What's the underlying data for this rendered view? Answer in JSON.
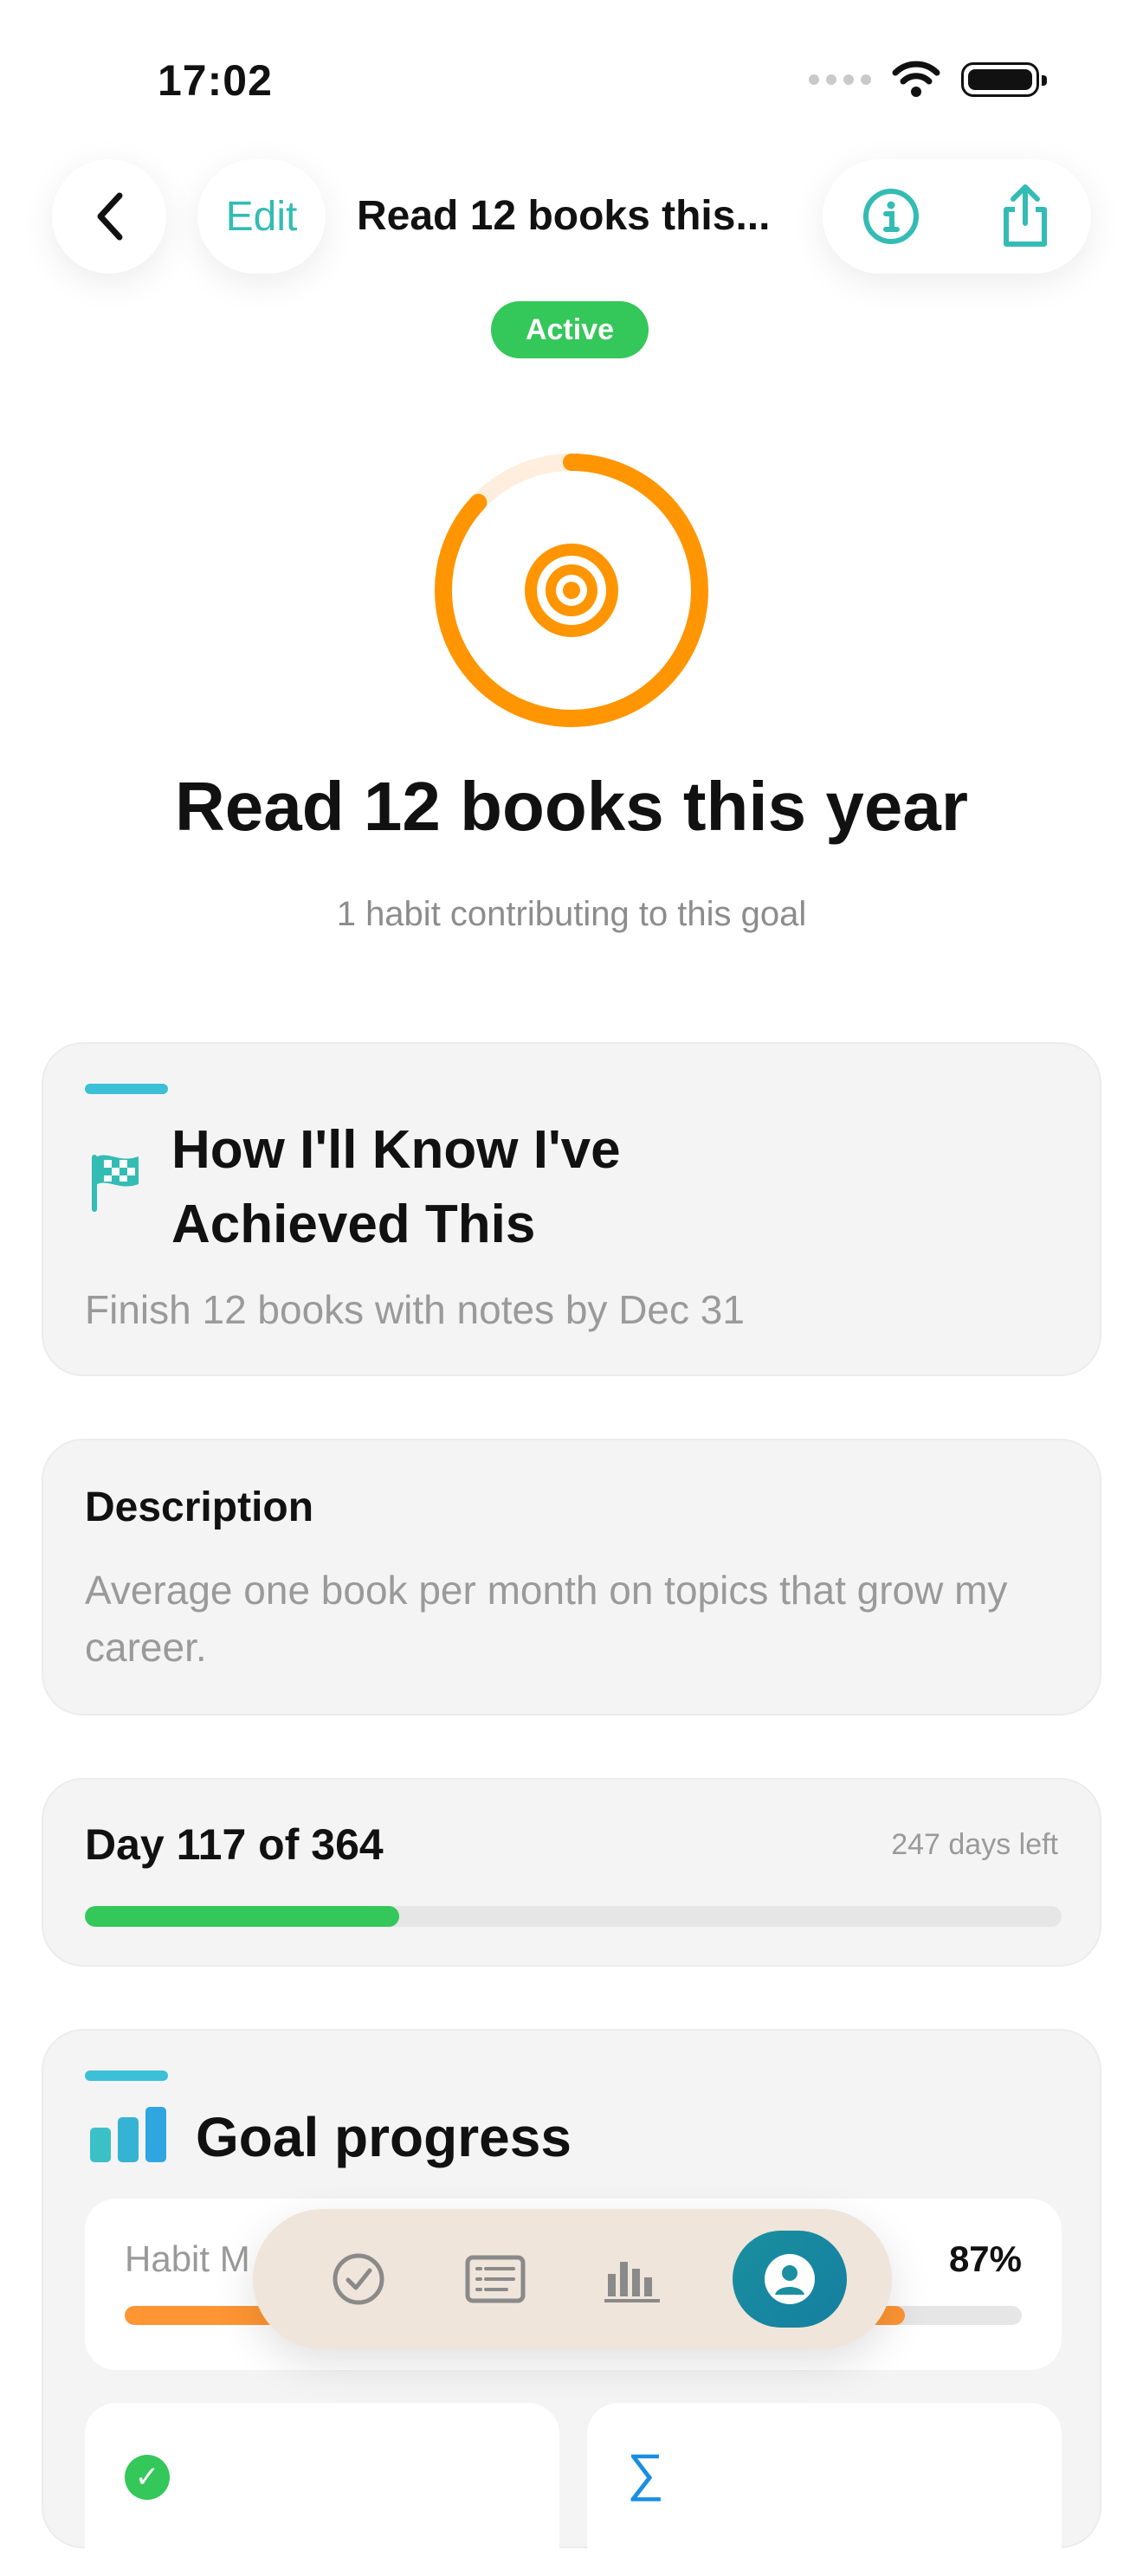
{
  "status_bar": {
    "time": "17:02"
  },
  "nav": {
    "edit_label": "Edit",
    "title": "Read 12 books this..."
  },
  "status_badge": "Active",
  "goal": {
    "title": "Read 12 books this year",
    "subtitle": "1 habit contributing to this goal",
    "ring_progress": 0.87,
    "ring_color": "#ff9500"
  },
  "achievement_card": {
    "heading": "How I'll Know I've Achieved This",
    "text": "Finish 12 books with notes by Dec 31"
  },
  "description_card": {
    "heading": "Description",
    "text": "Average one book per month on topics that grow my career."
  },
  "day_card": {
    "label": "Day 117 of 364",
    "days_left": "247 days left",
    "progress": 0.3214
  },
  "progress_card": {
    "heading": "Goal progress",
    "habit_label": "Habit M",
    "habit_percent": "87%",
    "habit_progress": 0.87
  },
  "tab_bar": {
    "tabs": [
      {
        "name": "check-circle-icon"
      },
      {
        "name": "list-icon"
      },
      {
        "name": "chart-icon"
      },
      {
        "name": "person-icon",
        "active": true
      }
    ]
  },
  "colors": {
    "accent_teal": "#33bcb4",
    "green": "#34c759",
    "orange": "#ff9533",
    "active_tab": "#1a8f9f"
  }
}
